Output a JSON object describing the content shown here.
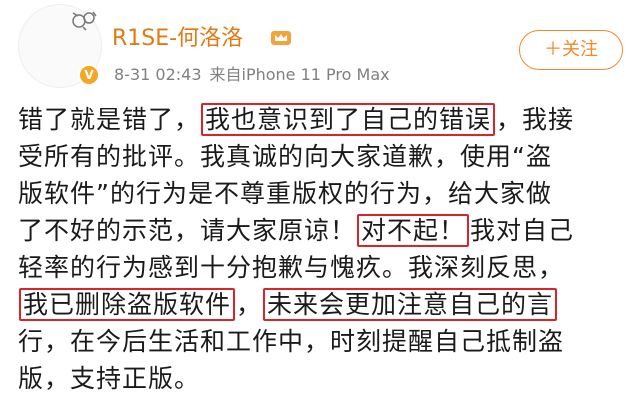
{
  "header": {
    "username": "R1SE-何洛洛",
    "timestamp": "8-31 02:43",
    "source": "来自iPhone 11 Pro Max",
    "follow_label": "＋关注",
    "verified_glyph": "V"
  },
  "colors": {
    "username": "#e07a12",
    "highlight_box": "#d8242b",
    "follow": "#f08a2a",
    "meta": "#808080"
  },
  "post": {
    "lines": [
      {
        "segments": [
          {
            "text": "错了就是错了，",
            "hl": false
          },
          {
            "text": "我也意识到了自己的错误",
            "hl": true
          },
          {
            "text": "，我接",
            "hl": false
          }
        ]
      },
      {
        "segments": [
          {
            "text": "受所有的批评。我真诚的向大家道歉，使用“盗",
            "hl": false
          }
        ]
      },
      {
        "segments": [
          {
            "text": "版软件”的行为是不尊重版权的行为，给大家做",
            "hl": false
          }
        ]
      },
      {
        "segments": [
          {
            "text": "了不好的示范，请大家原谅！",
            "hl": false
          },
          {
            "text": "对不起！",
            "hl": true
          },
          {
            "text": "我对自己",
            "hl": false
          }
        ]
      },
      {
        "segments": [
          {
            "text": "轻率的行为感到十分抱歉与愧疚。我深刻反思，",
            "hl": false
          }
        ]
      },
      {
        "segments": [
          {
            "text": "我已删除盗版软件",
            "hl": true
          },
          {
            "text": "，",
            "hl": false
          },
          {
            "text": "未来会更加注意自己的言",
            "hl": true
          }
        ]
      },
      {
        "segments": [
          {
            "text": "行，在今后生活和工作中，时刻提醒自己抵制盗",
            "hl": false
          }
        ]
      },
      {
        "segments": [
          {
            "text": "版，支持正版。",
            "hl": false
          }
        ]
      }
    ]
  }
}
